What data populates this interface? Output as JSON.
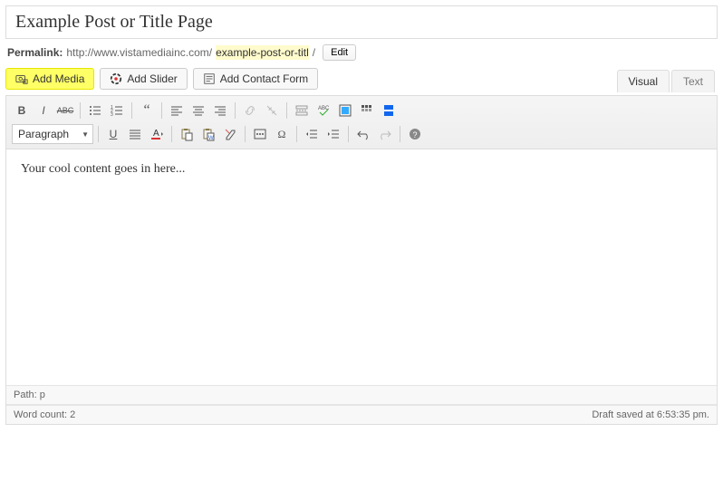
{
  "title": "Example Post or Title Page",
  "permalink": {
    "label": "Permalink:",
    "base": "http://www.vistamediainc.com/",
    "slug": "example-post-or-titl",
    "edit": "Edit"
  },
  "buttons": {
    "add_media": "Add Media",
    "add_slider": "Add Slider",
    "add_contact": "Add Contact Form"
  },
  "tabs": {
    "visual": "Visual",
    "text": "Text"
  },
  "format_select": "Paragraph",
  "content": "Your cool content goes in here...",
  "statusbar": {
    "path": "Path: p",
    "wordcount": "Word count: 2",
    "draft": "Draft saved at 6:53:35 pm."
  },
  "toolbar_icons": {
    "row1": [
      "bold",
      "italic",
      "strike",
      "ul",
      "ol",
      "quote",
      "align-left",
      "align-center",
      "align-right",
      "link",
      "unlink",
      "more",
      "spell",
      "fullscreen",
      "kitchen-sink",
      "break"
    ],
    "row2": [
      "underline",
      "justify",
      "textcolor",
      "paste",
      "paste-word",
      "clear",
      "embed",
      "char",
      "outdent",
      "indent",
      "undo",
      "redo",
      "help"
    ]
  }
}
